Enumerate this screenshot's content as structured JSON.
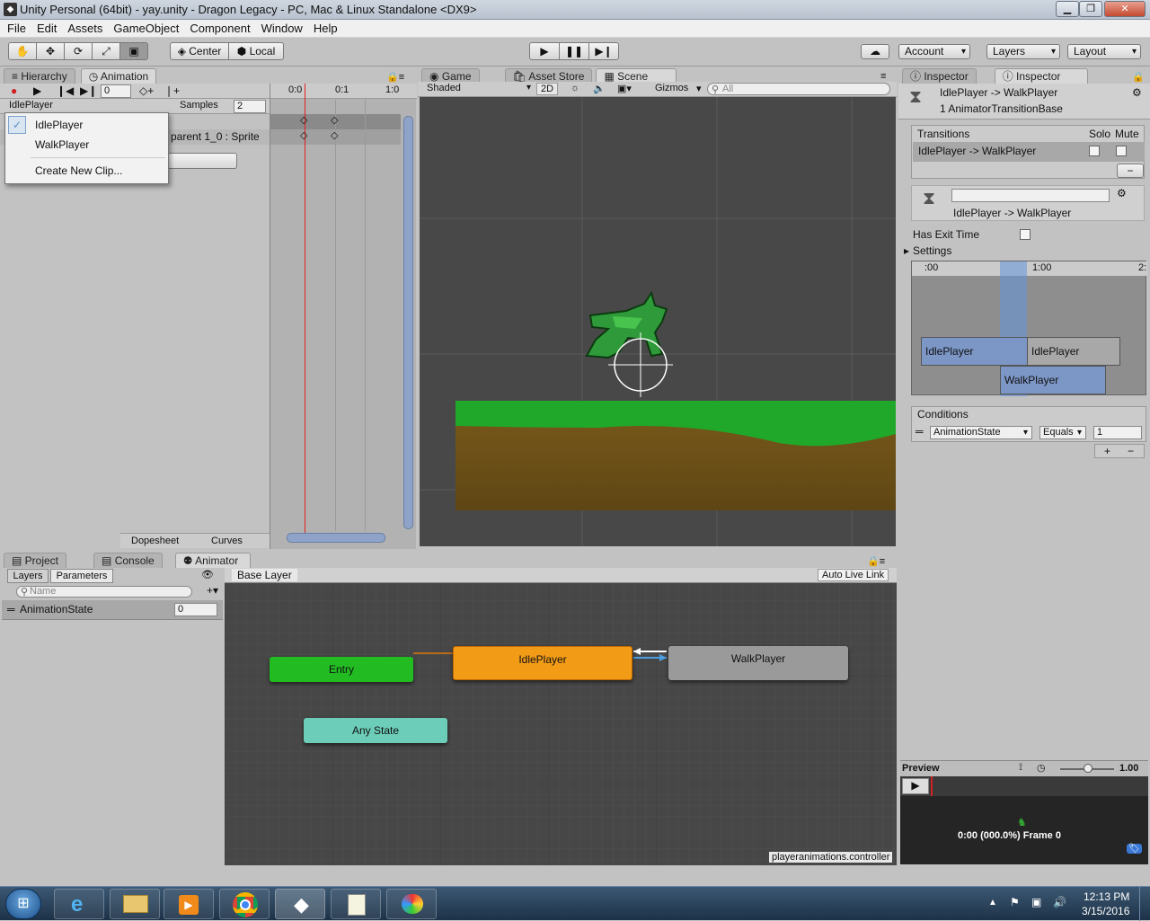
{
  "window": {
    "title": "Unity Personal (64bit) - yay.unity - Dragon Legacy - PC, Mac & Linux Standalone <DX9>",
    "icon": "unity-logo-icon"
  },
  "menu": [
    "File",
    "Edit",
    "Assets",
    "GameObject",
    "Component",
    "Window",
    "Help"
  ],
  "toolbar": {
    "tools": [
      "hand-icon",
      "move-icon",
      "rotate-icon",
      "scale-icon",
      "rect-tool-icon"
    ],
    "pivot": "Center",
    "space": "Local",
    "playback": [
      "play-icon",
      "pause-icon",
      "step-icon"
    ],
    "account": "Account",
    "layers": "Layers",
    "layout": "Layout"
  },
  "left_tabs": {
    "hierarchy": "Hierarchy",
    "animation": "Animation"
  },
  "animation": {
    "frame": "0",
    "clip": "IdlePlayer",
    "samples_label": "Samples",
    "samples": "2",
    "property": "parent 1_0 : Sprite",
    "timeline_ticks": [
      "0:0",
      "0:1",
      "1:0"
    ],
    "dopesheet": "Dopesheet",
    "curves": "Curves",
    "dropdown": [
      "IdlePlayer",
      "WalkPlayer",
      "Create New Clip..."
    ]
  },
  "center_tabs": {
    "game": "Game",
    "asset_store": "Asset Store",
    "scene": "Scene"
  },
  "scene": {
    "shading": "Shaded",
    "mode_2d": "2D",
    "gizmos": "Gizmos",
    "search_placeholder": "All"
  },
  "inspector_tabs": [
    "Inspector",
    "Inspector"
  ],
  "inspector": {
    "title": "IdlePlayer -> WalkPlayer",
    "subtitle": "1 AnimatorTransitionBase",
    "transitions_label": "Transitions",
    "solo": "Solo",
    "mute": "Mute",
    "transition_row": "IdlePlayer -> WalkPlayer",
    "transition_name": "IdlePlayer -> WalkPlayer",
    "has_exit_time": "Has Exit Time",
    "settings": "Settings",
    "timeline_ticks": [
      ":00",
      "1:00",
      "2:"
    ],
    "bars": [
      "IdlePlayer",
      "IdlePlayer",
      "WalkPlayer"
    ],
    "conditions": "Conditions",
    "cond_param": "AnimationState",
    "cond_op": "Equals",
    "cond_value": "1",
    "preview": "Preview",
    "preview_speed": "1.00",
    "preview_time": "0:00 (000.0%) Frame 0"
  },
  "bottom_tabs": {
    "project": "Project",
    "console": "Console",
    "animator": "Animator"
  },
  "animator": {
    "layers_tab": "Layers",
    "parameters_tab": "Parameters",
    "search_placeholder": "Name",
    "param_name": "AnimationState",
    "param_value": "0",
    "breadcrumb": "Base Layer",
    "auto_live_link": "Auto Live Link",
    "states": {
      "entry": "Entry",
      "idle": "IdlePlayer",
      "walk": "WalkPlayer",
      "any": "Any State"
    },
    "footer": "playeranimations.controller",
    "colors": {
      "entry": "#22bb22",
      "idle": "#f29b16",
      "walk": "#9a9a9a",
      "any": "#6ccdb8"
    }
  },
  "taskbar": {
    "apps": [
      "start-orb-icon",
      "ie-icon",
      "explorer-icon",
      "media-player-icon",
      "chrome-icon",
      "unity-icon",
      "notepad-icon",
      "paint-icon"
    ],
    "time": "12:13 PM",
    "date": "3/15/2016"
  }
}
